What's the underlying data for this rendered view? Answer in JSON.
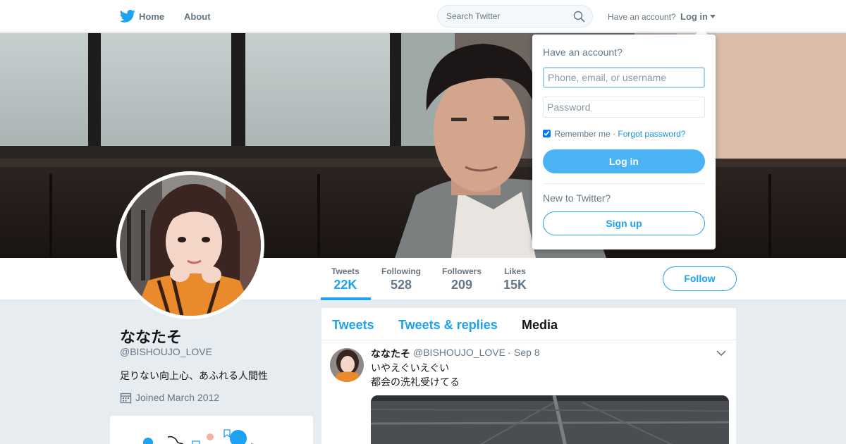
{
  "nav": {
    "home_label": "Home",
    "about_label": "About",
    "search_placeholder": "Search Twitter",
    "have_account_text": "Have an account?",
    "login_label": "Log in"
  },
  "profile_nav": {
    "stats": [
      {
        "label": "Tweets",
        "value": "22K"
      },
      {
        "label": "Following",
        "value": "528"
      },
      {
        "label": "Followers",
        "value": "209"
      },
      {
        "label": "Likes",
        "value": "15K"
      }
    ],
    "follow_label": "Follow"
  },
  "profile": {
    "name": "ななたそ",
    "handle": "@BISHOUJO_LOVE",
    "bio": "足りない向上心、あふれる人間性",
    "joined": "Joined March 2012"
  },
  "timeline": {
    "tabs": [
      "Tweets",
      "Tweets & replies",
      "Media"
    ],
    "selected_tab": "Media",
    "tweet": {
      "name": "ななたそ",
      "handle": "@BISHOUJO_LOVE",
      "separator": "·",
      "date": "Sep 8",
      "lines": [
        "いやえぐいえぐい",
        "都会の洗礼受けてる"
      ]
    }
  },
  "login_dropdown": {
    "title": "Have an account?",
    "username_placeholder": "Phone, email, or username",
    "password_placeholder": "Password",
    "remember_label": "Remember me",
    "separator": "·",
    "forgot_label": "Forgot password?",
    "login_button": "Log in",
    "new_text": "New to Twitter?",
    "signup_button": "Sign up"
  },
  "colors": {
    "accent": "#1da1f2",
    "login_button": "#4ab3f4",
    "page_bg": "#e6ecf0"
  },
  "icons": [
    "twitter-bird-icon",
    "search-icon",
    "chevron-down-icon",
    "calendar-icon"
  ]
}
